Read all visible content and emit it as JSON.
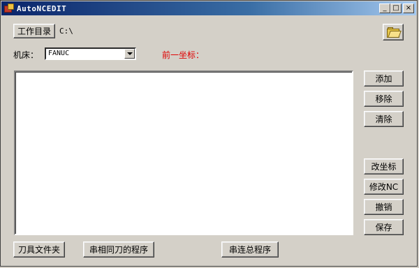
{
  "window": {
    "title": "AutoNCEDIT",
    "controls": {
      "minimize": "_",
      "maximize": "□",
      "close": "×"
    }
  },
  "workdir": {
    "button_label": "工作目录",
    "path": "C:\\"
  },
  "machine": {
    "label": "机床：",
    "selected": "FANUC"
  },
  "prev_coord": {
    "label": "前一坐标：",
    "color": "#e00000"
  },
  "side_buttons": {
    "add": "添加",
    "remove": "移除",
    "clear": "清除",
    "change_coord": "改坐标",
    "modify_nc": "修改NC",
    "undo": "撤销",
    "save": "保存"
  },
  "bottom_buttons": {
    "tool_folder": "刀具文件夹",
    "chain_same_tool": "串相同刀的程序",
    "chain_all": "串连总程序"
  },
  "icons": {
    "app": "app-icon",
    "folder": "folder-open-icon",
    "dropdown": "chevron-down-icon"
  }
}
